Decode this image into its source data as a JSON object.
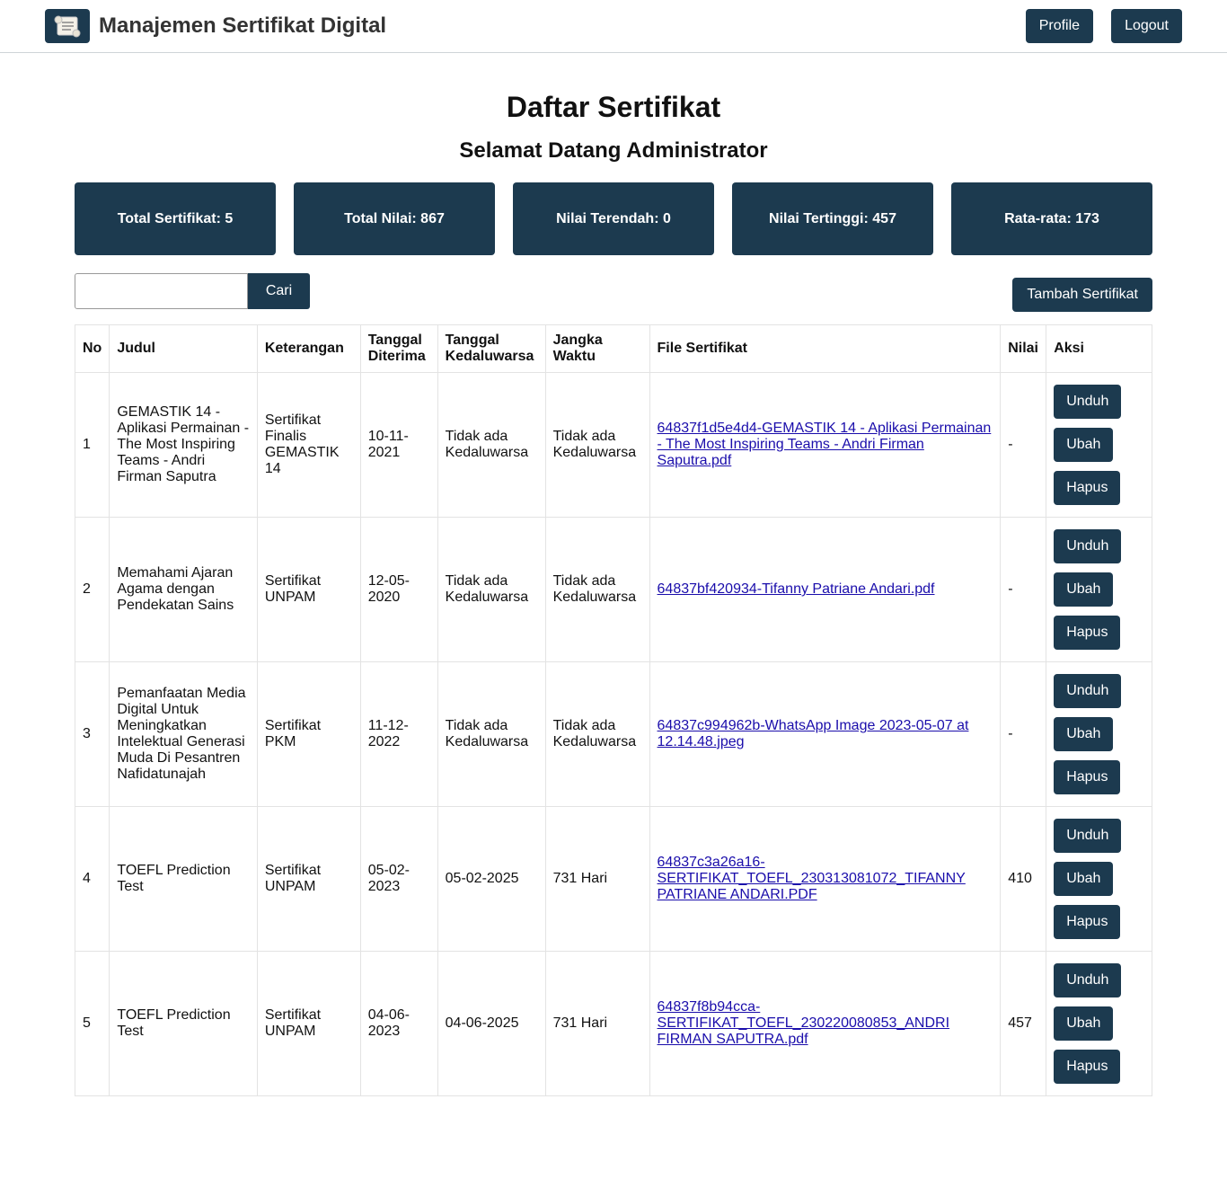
{
  "header": {
    "title": "Manajemen Sertifikat Digital",
    "profile": "Profile",
    "logout": "Logout"
  },
  "page": {
    "title": "Daftar Sertifikat",
    "welcome": "Selamat Datang Administrator"
  },
  "stats": [
    "Total Sertifikat: 5",
    "Total Nilai: 867",
    "Nilai Terendah: 0",
    "Nilai Tertinggi: 457",
    "Rata-rata: 173"
  ],
  "toolbar": {
    "search_value": "",
    "search_button": "Cari",
    "add_button": "Tambah Sertifikat"
  },
  "table": {
    "headers": [
      "No",
      "Judul",
      "Keterangan",
      "Tanggal Diterima",
      "Tanggal Kedaluwarsa",
      "Jangka Waktu",
      "File Sertifikat",
      "Nilai",
      "Aksi"
    ],
    "action_labels": {
      "download": "Unduh",
      "edit": "Ubah",
      "delete": "Hapus"
    },
    "rows": [
      {
        "no": "1",
        "judul": "GEMASTIK 14 - Aplikasi Permainan - The Most Inspiring Teams - Andri Firman Saputra",
        "keterangan": "Sertifikat Finalis GEMASTIK 14",
        "diterima": "10-11-2021",
        "kedaluwarsa": "Tidak ada Kedaluwarsa",
        "jangka": "Tidak ada Kedaluwarsa",
        "file": "64837f1d5e4d4-GEMASTIK 14 - Aplikasi Permainan - The Most Inspiring Teams - Andri Firman Saputra.pdf",
        "nilai": "-"
      },
      {
        "no": "2",
        "judul": "Memahami Ajaran Agama dengan Pendekatan Sains",
        "keterangan": "Sertifikat UNPAM",
        "diterima": "12-05-2020",
        "kedaluwarsa": "Tidak ada Kedaluwarsa",
        "jangka": "Tidak ada Kedaluwarsa",
        "file": "64837bf420934-Tifanny Patriane Andari.pdf",
        "nilai": "-"
      },
      {
        "no": "3",
        "judul": "Pemanfaatan Media Digital Untuk Meningkatkan Intelektual Generasi Muda Di Pesantren Nafidatunajah",
        "keterangan": "Sertifikat PKM",
        "diterima": "11-12-2022",
        "kedaluwarsa": "Tidak ada Kedaluwarsa",
        "jangka": "Tidak ada Kedaluwarsa",
        "file": "64837c994962b-WhatsApp Image 2023-05-07 at 12.14.48.jpeg",
        "nilai": "-"
      },
      {
        "no": "4",
        "judul": "TOEFL Prediction Test",
        "keterangan": "Sertifikat UNPAM",
        "diterima": "05-02-2023",
        "kedaluwarsa": "05-02-2025",
        "jangka": "731 Hari",
        "file": "64837c3a26a16-SERTIFIKAT_TOEFL_230313081072_TIFANNY PATRIANE ANDARI.PDF",
        "nilai": "410"
      },
      {
        "no": "5",
        "judul": "TOEFL Prediction Test",
        "keterangan": "Sertifikat UNPAM",
        "diterima": "04-06-2023",
        "kedaluwarsa": "04-06-2025",
        "jangka": "731 Hari",
        "file": "64837f8b94cca-SERTIFIKAT_TOEFL_230220080853_ANDRI FIRMAN SAPUTRA.pdf",
        "nilai": "457"
      }
    ]
  },
  "colors": {
    "primary": "#1c3a4f",
    "link": "#1a0dab"
  }
}
